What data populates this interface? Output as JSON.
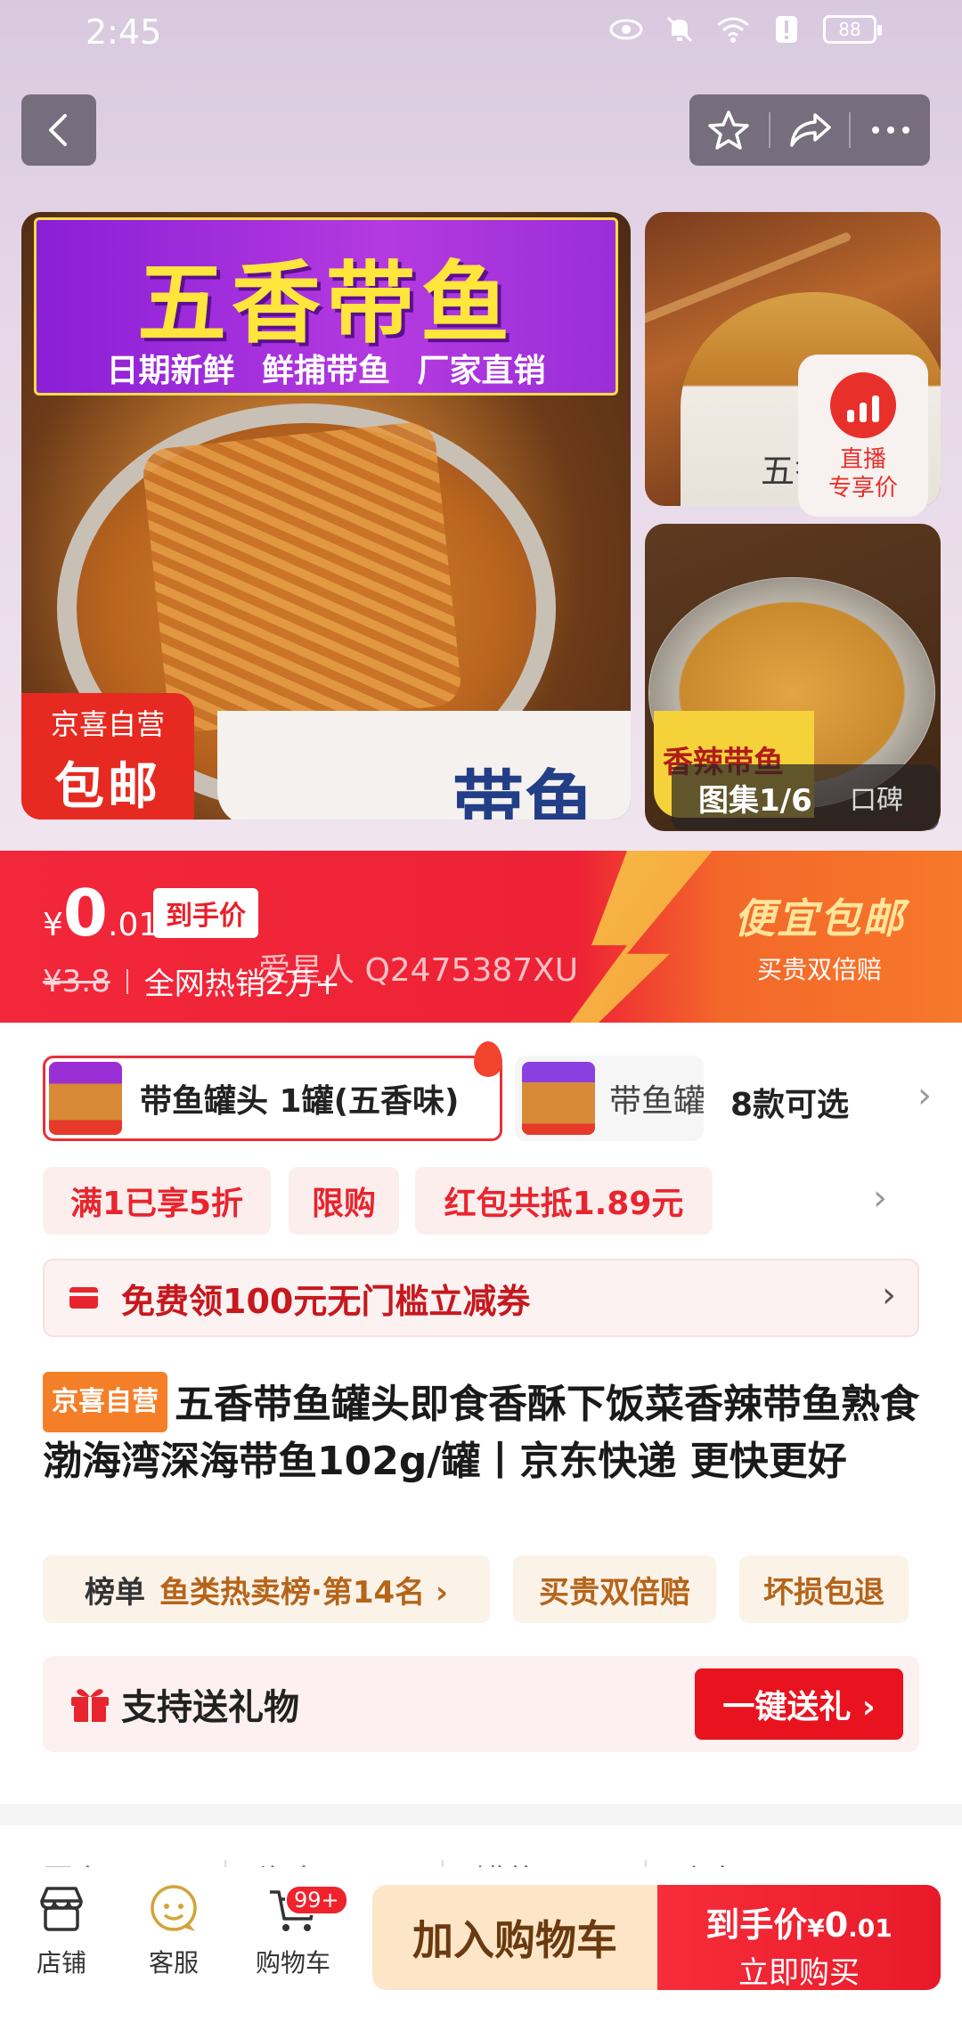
{
  "status_bar": {
    "time": "2:45",
    "battery": "88"
  },
  "gallery": {
    "main_banner_title": "五香带鱼",
    "main_banner_subtitle": "日期新鲜 鲜捕带鱼 厂家直销",
    "main_can_label": "带鱼",
    "badge_line1": "京喜自营",
    "badge_line2": "包邮",
    "side1_can_label": "五香带",
    "side2_can_label": "香辣带鱼",
    "live_line1": "直播",
    "live_line2": "专享价",
    "index_label": "图集1/6",
    "reviews_label": "口碑"
  },
  "price": {
    "currency": "¥",
    "integer": "0",
    "decimal": ".01",
    "final_label": "到手价",
    "original": "¥3.8",
    "hot_sales": "全网热销2万+",
    "overlay_id": "爱星人 Q2475387XU",
    "promo_title": "便宜包邮",
    "promo_sub": "买贵双倍赔"
  },
  "variants": {
    "selected": "带鱼罐头 1罐(五香味)",
    "other": "带鱼罐头",
    "count": "8款可选"
  },
  "promos": [
    "满1已享5折",
    "限购",
    "红包共抵1.89元"
  ],
  "coupon": {
    "text": "免费领100元无门槛立减券"
  },
  "product": {
    "store_tag": "京喜自营",
    "title": "五香带鱼罐头即食香酥下饭菜香辣带鱼熟食渤海湾深海带鱼102g/罐丨京东快递 更快更好"
  },
  "tags": {
    "rank_key": "榜单",
    "rank_value": "鱼类热卖榜·第14名 ›",
    "tag2": "买贵双倍赔",
    "tag3": "坏损包退"
  },
  "gift": {
    "text": "支持送礼物",
    "button": "一键送礼 ›"
  },
  "peek_row": [
    "国产",
    "海水",
    "罐装",
    "山东"
  ],
  "bottom_bar": {
    "store": "店铺",
    "service": "客服",
    "cart": "购物车",
    "cart_badge": "99+",
    "add_to_cart": "加入购物车",
    "buy_price_label": "到手价",
    "buy_price_currency": "¥",
    "buy_price_int": "0",
    "buy_price_dec": ".01",
    "buy_now": "立即购买"
  },
  "colors": {
    "accent_red": "#e8202b",
    "promo_gold": "#ffe59a",
    "store_tag": "#f57f29"
  }
}
